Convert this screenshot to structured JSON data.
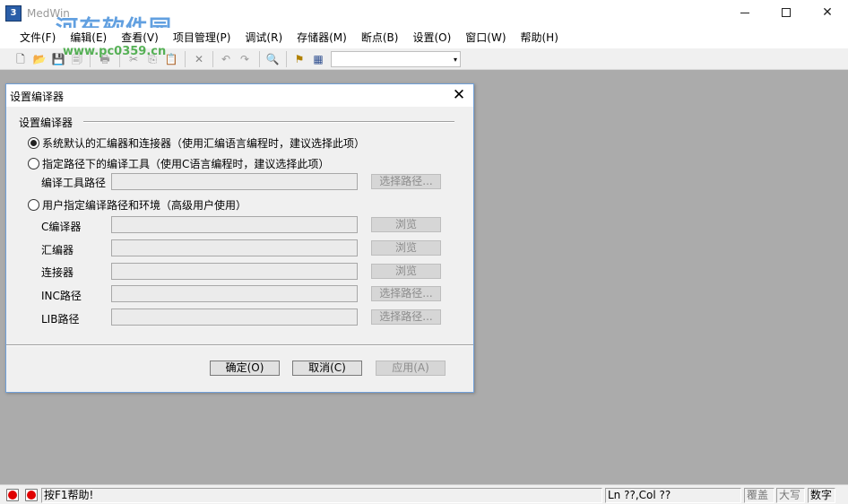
{
  "window": {
    "app_icon_text": "3",
    "title": "MedWin",
    "watermark": "河东软件园",
    "watermark_url": "www.pc0359.cn",
    "minimize_glyph": "",
    "maximize_glyph": "",
    "close_glyph": "✕"
  },
  "menu": [
    {
      "label": "文件(F)"
    },
    {
      "label": "编辑(E)"
    },
    {
      "label": "查看(V)"
    },
    {
      "label": "项目管理(P)"
    },
    {
      "label": "调试(R)"
    },
    {
      "label": "存储器(M)"
    },
    {
      "label": "断点(B)"
    },
    {
      "label": "设置(O)"
    },
    {
      "label": "窗口(W)"
    },
    {
      "label": "帮助(H)"
    }
  ],
  "toolbar": {
    "new_icon": "🗋",
    "open_icon": "📂",
    "save_icon": "💾",
    "save_all_icon": "🗐",
    "print_icon": "🖶",
    "cut_icon": "✂",
    "copy_icon": "⎘",
    "paste_icon": "📋",
    "delete_icon": "✕",
    "undo_icon": "↶",
    "redo_icon": "↷",
    "find_icon": "🔍",
    "tool1_icon": "⚑",
    "tool2_icon": "▦",
    "combo_value": "",
    "combo_arrow": "▾"
  },
  "dialog": {
    "title": "设置编译器",
    "close_glyph": "✕",
    "group_label": "设置编译器",
    "options": {
      "default": "系统默认的汇编器和连接器（使用汇编语言编程时，建议选择此项）",
      "tool_path": "指定路径下的编译工具（使用C语言编程时，建议选择此项）",
      "user_path": "用户指定编译路径和环境（高级用户使用）"
    },
    "selected_option": "default",
    "tool_path_label": "编译工具路径",
    "tool_path_value": "",
    "select_path_button": "选择路径...",
    "fields": {
      "c_compiler": {
        "label": "C编译器",
        "value": "",
        "button": "浏览"
      },
      "assembler": {
        "label": "汇编器",
        "value": "",
        "button": "浏览"
      },
      "linker": {
        "label": "连接器",
        "value": "",
        "button": "浏览"
      },
      "inc_path": {
        "label": "INC路径",
        "value": "",
        "button": "选择路径..."
      },
      "lib_path": {
        "label": "LIB路径",
        "value": "",
        "button": "选择路径..."
      }
    },
    "ok_button": "确定(O)",
    "cancel_button": "取消(C)",
    "apply_button": "应用(A)"
  },
  "statusbar": {
    "help_text": "按F1帮助!",
    "position": "Ln ??,Col ??",
    "overwrite": "覆盖",
    "caps": "大写",
    "num": "数字",
    "led_color": "#e00000"
  }
}
